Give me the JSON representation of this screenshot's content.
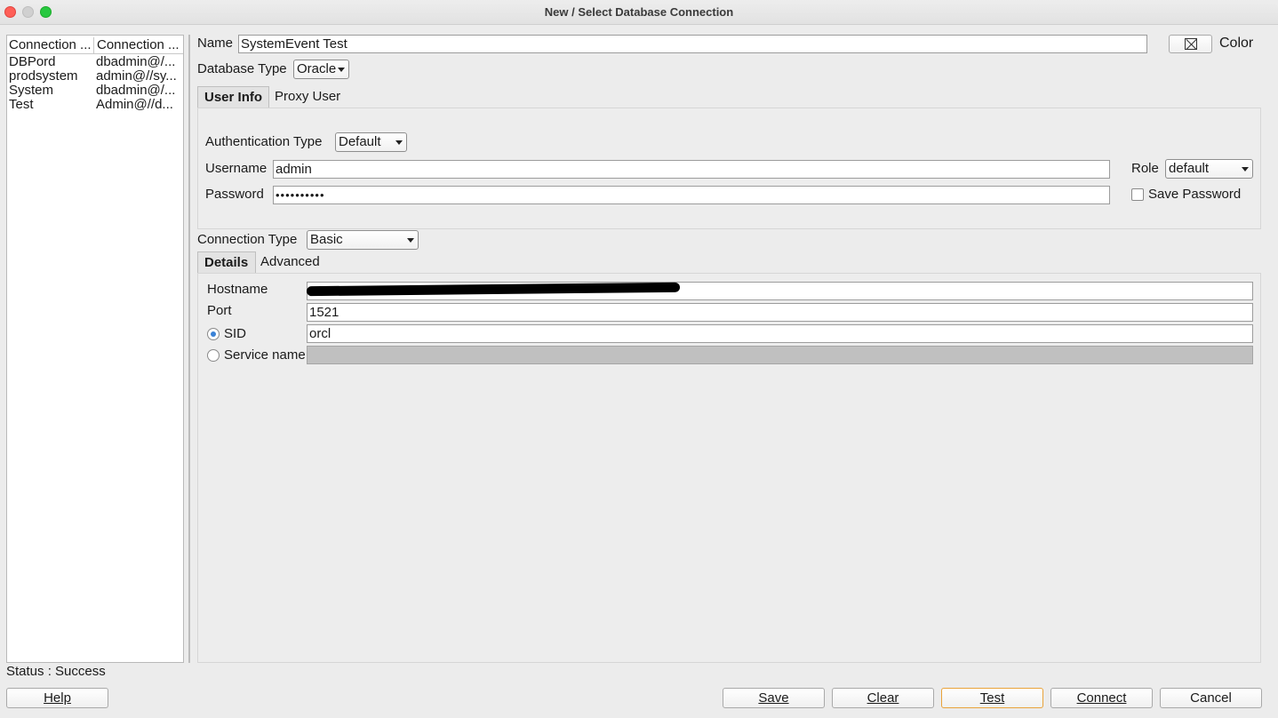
{
  "window": {
    "title": "New / Select Database Connection"
  },
  "connections": {
    "headers": [
      "Connection ...",
      "Connection ..."
    ],
    "rows": [
      {
        "name": "DBPord",
        "details": "dbadmin@/..."
      },
      {
        "name": "prodsystem",
        "details": "admin@//sy..."
      },
      {
        "name": "System",
        "details": "dbadmin@/..."
      },
      {
        "name": "Test",
        "details": "Admin@//d..."
      }
    ]
  },
  "form": {
    "name_label": "Name",
    "name_value": "SystemEvent Test",
    "color_label": "Color",
    "db_type_label": "Database Type",
    "db_type_value": "Oracle",
    "tabs": [
      "User Info",
      "Proxy User"
    ],
    "auth_type_label": "Authentication Type",
    "auth_type_value": "Default",
    "username_label": "Username",
    "username_value": "admin",
    "password_label": "Password",
    "password_value": "••••••••••",
    "role_label": "Role",
    "role_value": "default",
    "save_password_label": "Save Password",
    "conn_type_label": "Connection Type",
    "conn_type_value": "Basic",
    "detail_tabs": [
      "Details",
      "Advanced"
    ],
    "hostname_label": "Hostname",
    "port_label": "Port",
    "port_value": "1521",
    "sid_label": "SID",
    "sid_value": "orcl",
    "service_label": "Service name"
  },
  "status": {
    "text": "Status : Success"
  },
  "buttons": {
    "help": "Help",
    "save": "Save",
    "clear": "Clear",
    "test": "Test",
    "connect": "Connect",
    "cancel": "Cancel"
  },
  "icons": {
    "color_button": "no-color-icon"
  }
}
